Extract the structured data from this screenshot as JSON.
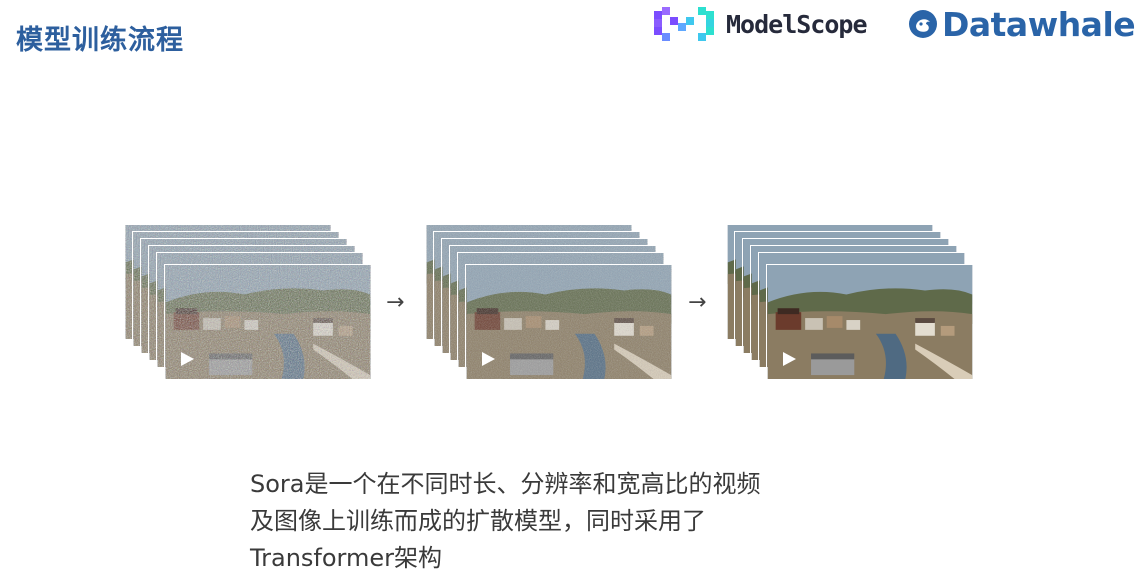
{
  "slide": {
    "title": "模型训练流程"
  },
  "logos": {
    "modelscope": "ModelScope",
    "datawhale": "Datawhale",
    "modelscope_colors": [
      "#7b4dff",
      "#5fa8ff",
      "#2de0d0"
    ],
    "datawhale_color": "#2a64a8"
  },
  "diagram": {
    "stages": [
      {
        "name": "stage-noise",
        "noise_level": 0.95,
        "icon": "play-icon"
      },
      {
        "name": "stage-partial",
        "noise_level": 0.5,
        "icon": "play-icon"
      },
      {
        "name": "stage-clean",
        "noise_level": 0.0,
        "icon": "play-icon"
      }
    ],
    "arrow": "→"
  },
  "caption": {
    "line1": "Sora是一个在不同时长、分辨率和宽高比的视频",
    "line2": "及图像上训练而成的扩散模型，同时采用了",
    "line3": "Transformer架构"
  }
}
